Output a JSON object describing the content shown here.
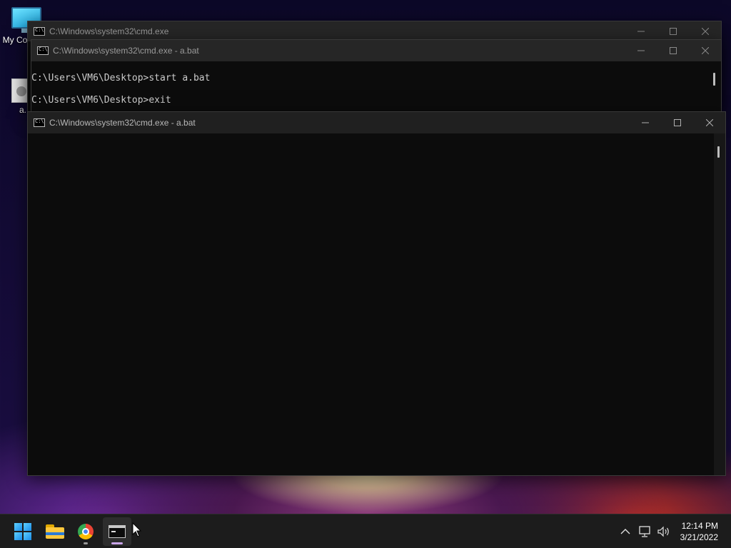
{
  "desktop": {
    "icons": [
      {
        "label": "My Co",
        "icon": "computer-icon"
      },
      {
        "label": "a.",
        "icon": "batch-file-icon"
      }
    ]
  },
  "windows": {
    "back": {
      "title": "C:\\Windows\\system32\\cmd.exe"
    },
    "middle": {
      "title": "C:\\Windows\\system32\\cmd.exe - a.bat",
      "lines": [
        "C:\\Users\\VM6\\Desktop>start a.bat",
        "C:\\Users\\VM6\\Desktop>exit"
      ]
    },
    "front": {
      "title": "C:\\Windows\\system32\\cmd.exe - a.bat"
    }
  },
  "taskbar": {
    "apps": [
      {
        "name": "start",
        "icon": "windows-logo-icon"
      },
      {
        "name": "file-explorer",
        "icon": "folder-icon"
      },
      {
        "name": "chrome",
        "icon": "chrome-icon"
      },
      {
        "name": "command-prompt",
        "icon": "terminal-icon",
        "active": true
      }
    ],
    "tray": {
      "icons": [
        "chevron-up-icon",
        "network-icon",
        "volume-icon"
      ],
      "time": "12:14 PM",
      "date": "3/21/2022"
    }
  },
  "colors": {
    "console_bg": "#0c0c0c",
    "console_text": "#cccccc",
    "titlebar": "#202020",
    "taskbar": "#1c1c1c"
  }
}
